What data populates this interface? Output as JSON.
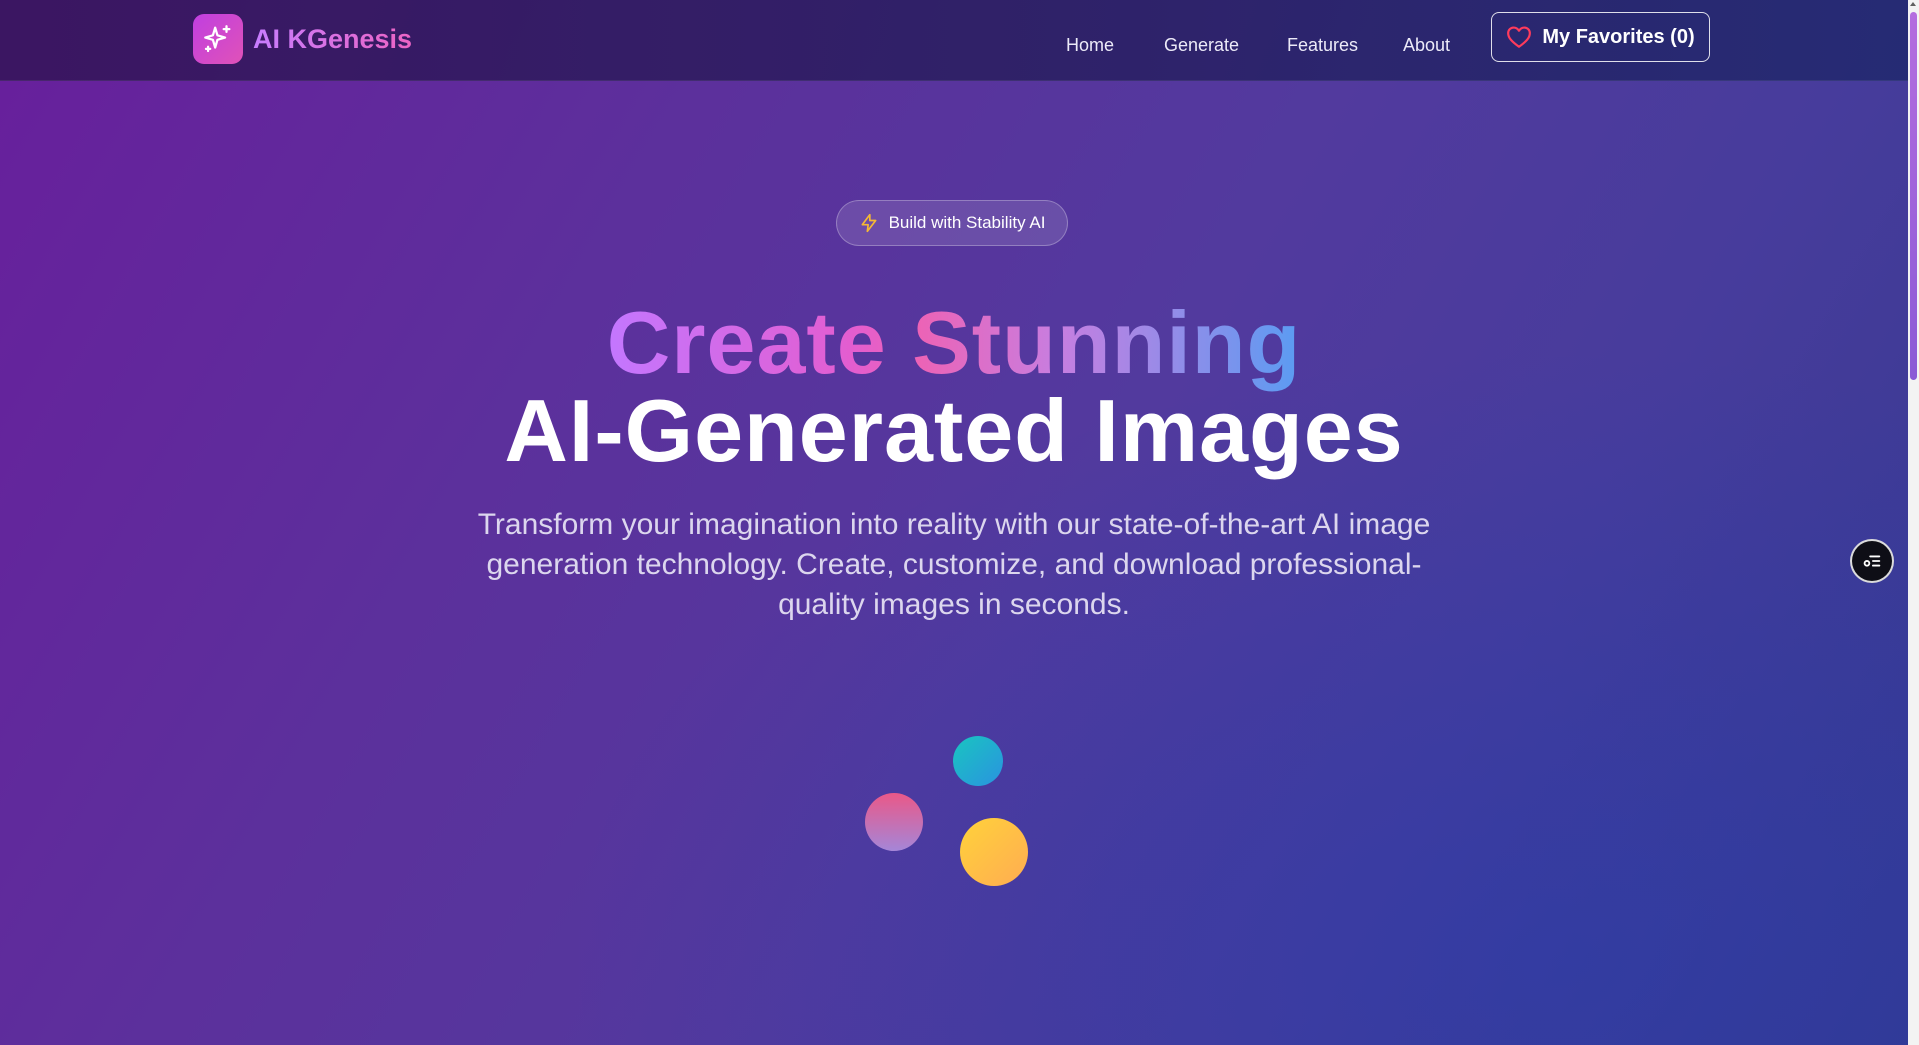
{
  "brand": {
    "name": "AI KGenesis",
    "logo_icon": "sparkles-icon"
  },
  "nav": {
    "items": [
      {
        "label": "Home"
      },
      {
        "label": "Generate"
      },
      {
        "label": "Features"
      },
      {
        "label": "About"
      }
    ],
    "favorites_label": "My Favorites (0)",
    "favorites_icon": "heart-icon"
  },
  "hero": {
    "badge_label": "Build with Stability AI",
    "badge_icon": "lightning-icon",
    "headline_gradient": "Create Stunning",
    "headline_plain": "AI-Generated Images",
    "subtitle": "Transform your imagination into reality with our state-of-the-art AI image generation technology. Create, customize, and download professional-quality images in seconds."
  },
  "floating_button": {
    "icon": "filter-list-icon"
  },
  "colors": {
    "brand_gradient_start": "#c03fe0",
    "brand_gradient_end": "#e052b8",
    "heart": "#ff3b5c",
    "lightning": "#f5b834",
    "background_start": "#681f9c",
    "background_end": "#35398f"
  }
}
